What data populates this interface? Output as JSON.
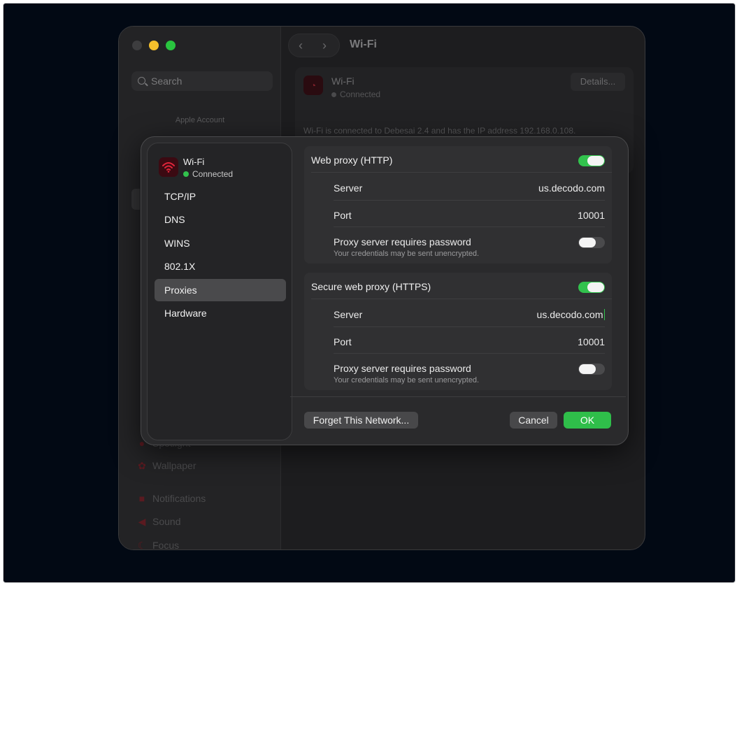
{
  "background_window": {
    "search_placeholder": "Search",
    "apple_account": "Apple Account",
    "title": "Wi-Fi",
    "network_name": "Wi-Fi",
    "network_status": "Connected",
    "details_button": "Details...",
    "info_text": "Wi-Fi is connected to Debesai 2.4 and has the IP address 192.168.0.108.",
    "sidebar_items": [
      {
        "label": "Spotlight",
        "icon": "magnifier-icon"
      },
      {
        "label": "Wallpaper",
        "icon": "flower-icon"
      },
      {
        "label": "Notifications",
        "icon": "bell-icon"
      },
      {
        "label": "Sound",
        "icon": "speaker-icon"
      },
      {
        "label": "Focus",
        "icon": "moon-icon"
      }
    ]
  },
  "sheet": {
    "network": {
      "name": "Wi-Fi",
      "status": "Connected",
      "status_color": "#32c24d",
      "icon": "wifi-icon"
    },
    "nav": [
      {
        "label": "TCP/IP",
        "selected": false
      },
      {
        "label": "DNS",
        "selected": false
      },
      {
        "label": "WINS",
        "selected": false
      },
      {
        "label": "802.1X",
        "selected": false
      },
      {
        "label": "Proxies",
        "selected": true
      },
      {
        "label": "Hardware",
        "selected": false
      }
    ],
    "http_proxy": {
      "title": "Web proxy (HTTP)",
      "enabled": true,
      "server_label": "Server",
      "server_value": "us.decodo.com",
      "port_label": "Port",
      "port_value": "10001",
      "password_label": "Proxy server requires password",
      "password_note": "Your credentials may be sent unencrypted.",
      "password_required": false
    },
    "https_proxy": {
      "title": "Secure web proxy (HTTPS)",
      "enabled": true,
      "server_label": "Server",
      "server_value": "us.decodo.com",
      "port_label": "Port",
      "port_value": "10001",
      "password_label": "Proxy server requires password",
      "password_note": "Your credentials may be sent unencrypted.",
      "password_required": false
    },
    "buttons": {
      "forget": "Forget This Network...",
      "cancel": "Cancel",
      "ok": "OK"
    },
    "accent_color": "#32c24d"
  }
}
